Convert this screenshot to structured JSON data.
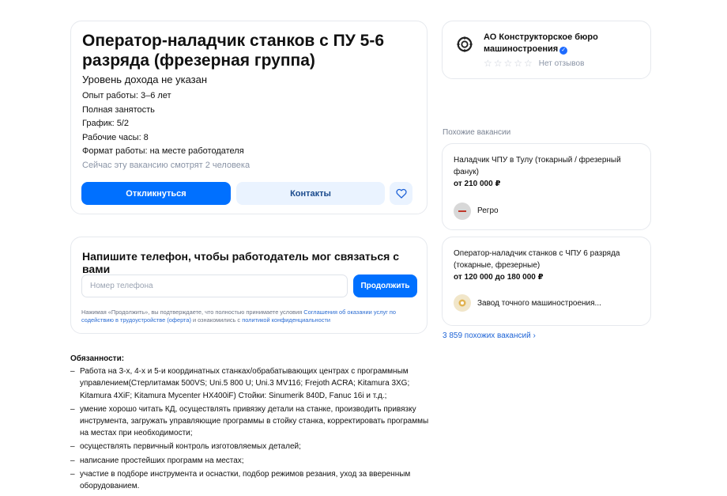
{
  "vacancy": {
    "title": "Оператор-наладчик станков с ПУ 5-6 разряда (фрезерная группа)",
    "salary": "Уровень дохода не указан",
    "experience": "Опыт работы: 3–6 лет",
    "employment": "Полная занятость",
    "schedule": "График: 5/2",
    "hours": "Рабочие часы: 8",
    "work_format": "Формат работы: на месте работодателя",
    "viewers": "Сейчас эту вакансию смотрят 2 человека",
    "respond_label": "Откликнуться",
    "contacts_label": "Контакты"
  },
  "phone_form": {
    "title": "Напишите телефон, чтобы работодатель мог связаться с вами",
    "placeholder": "Номер телефона",
    "continue_label": "Продолжить",
    "legal_prefix": "Нажимая «Продолжить», вы подтверждаете, что полностью принимаете условия ",
    "legal_offer_link": "Соглашения об оказании услуг по содействию в трудоустройстве (оферта)",
    "legal_middle": " и ознакомились с ",
    "legal_privacy_link": "политикой конфиденциальности"
  },
  "description": {
    "duties_title": "Обязанности:",
    "duties": [
      "Работа на 3-х, 4-х и 5-и координатных станках/обрабатывающих центрах с программным управлением(Стерлитамак 500VS; Uni.5 800 U; Uni.3 MV116; Frejoth ACRA; Kitamura 3XG; Kitamura 4XiF; Kitamura Mycenter HX400iF) Стойки: Sinumerik 840D, Fanuc 16i и т.д.;",
      "умение хорошо читать КД, осуществлять привязку детали на станке, производить привязку инструмента, загружать управляющие программы в стойку станка, корректировать программы на местах при необходимости;",
      "осуществлять первичный контроль изготовляемых деталей;",
      "написание простейших программ на местах;",
      "участие в подборе инструмента и оснастки, подбор режимов резания, уход за вверенным оборудованием."
    ]
  },
  "company": {
    "name": "АО Конструкторское бюро машиностроения",
    "verified_mark": "✓",
    "stars": "☆☆☆☆☆",
    "reviews": "Нет отзывов",
    "logo_icon": "gear-globe-icon"
  },
  "similar": {
    "heading": "Похожие вакансии",
    "items": [
      {
        "title": "Наладчик ЧПУ в Тулу (токарный / фрезерный фанук)",
        "salary": "от 210 000 ₽",
        "company": "Регро",
        "logo_color": "#d8d8d8"
      },
      {
        "title": "Оператор-наладчик станков с ЧПУ 6 разряда (токарные, фрезерные)",
        "salary": "от 120 000 до 180 000 ₽",
        "company": "Завод точного машиностроения...",
        "logo_color": "#f1e6c9"
      }
    ],
    "more_label": "3 859 похожих вакансий",
    "more_chevron": "›"
  },
  "colors": {
    "primary": "#0070ff",
    "secondary_button_bg": "#eaf3ff",
    "muted_text": "#8a94a6",
    "link": "#1e64d6"
  }
}
